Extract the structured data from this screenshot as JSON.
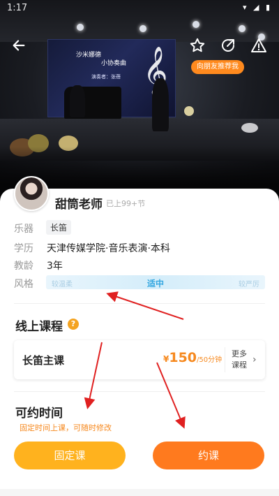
{
  "status_bar": {
    "time": "1:17",
    "icons": "▾ ◢ ▮"
  },
  "hero": {
    "screen_line1": "沙米娜德",
    "screen_line2": "小协奏曲",
    "screen_line3": "演奏者：张蓓",
    "recommend_tag": "向朋友推荐我"
  },
  "icons": {
    "back": "arrow-left-icon",
    "favorite": "star-outline-icon",
    "share": "share-icon",
    "report": "warning-icon",
    "help": "question-icon",
    "more": "chevron-right-icon"
  },
  "teacher": {
    "name": "甜筒老师",
    "lessons": "已上99+节"
  },
  "info": {
    "instrument_label": "乐器",
    "instrument_value": "长笛",
    "education_label": "学历",
    "education_value": "天津传媒学院·音乐表演·本科",
    "experience_label": "教龄",
    "experience_value": "3年",
    "style_label": "风格",
    "style_low": "较温柔",
    "style_mid": "适中",
    "style_high": "较严厉"
  },
  "online_courses": {
    "title": "线上课程",
    "course_name": "长笛主课",
    "currency": "¥",
    "price": "150",
    "unit": "/50分钟",
    "more": "更多课程"
  },
  "availability": {
    "title": "可约时间",
    "subtitle": "固定时间上课，可随时修改"
  },
  "actions": {
    "fixed": "固定课",
    "book": "约课"
  },
  "colors": {
    "accent_orange": "#ff7a1e",
    "accent_yellow": "#ffb21e",
    "price_orange": "#f6891f",
    "style_blue": "#34a7e0",
    "annotation_red": "#e02020"
  }
}
